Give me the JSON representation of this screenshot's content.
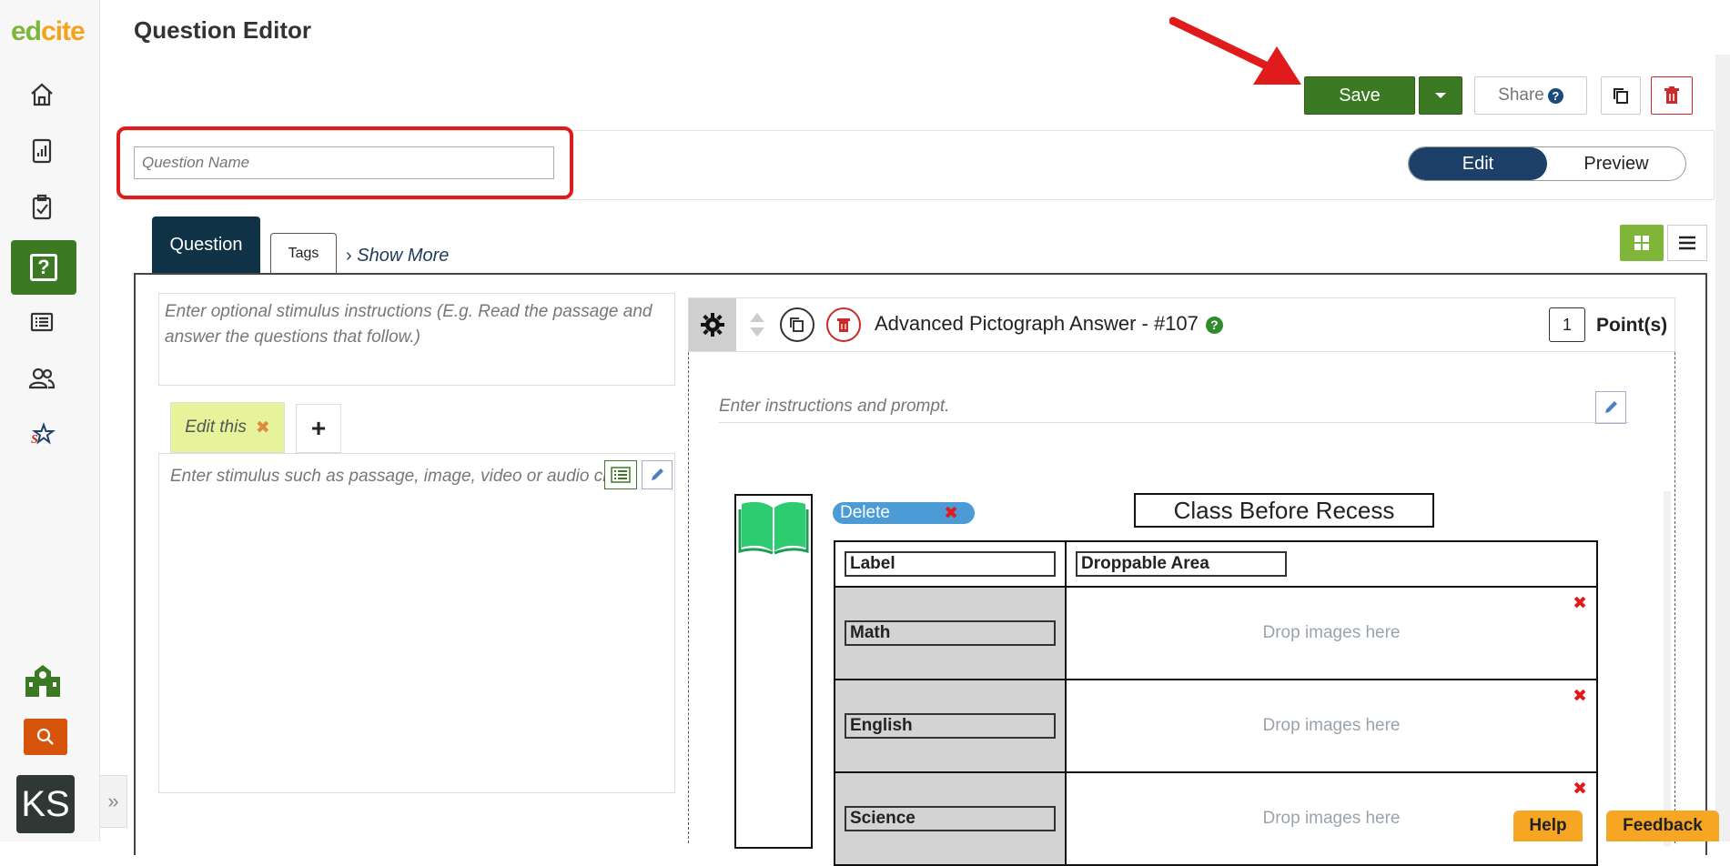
{
  "brand": {
    "logo_text_1": "ed",
    "logo_text_2": "cite"
  },
  "sidebar": {
    "items": [
      {
        "icon": "home-icon"
      },
      {
        "icon": "reports-icon"
      },
      {
        "icon": "assignments-icon"
      },
      {
        "icon": "question-icon",
        "active": true,
        "glyph": "?"
      },
      {
        "icon": "list-icon"
      },
      {
        "icon": "users-icon"
      },
      {
        "icon": "star-logo-icon"
      }
    ],
    "bottom": {
      "school_icon": "school-icon",
      "search_icon": "search-icon",
      "avatar_initials": "KS",
      "collapse": "»"
    }
  },
  "header": {
    "title": "Question Editor",
    "save_label": "Save",
    "share_label": "Share",
    "share_help": "?"
  },
  "name_field": {
    "placeholder": "Question Name",
    "value": ""
  },
  "mode_toggle": {
    "edit": "Edit",
    "preview": "Preview",
    "selected": "Edit"
  },
  "tabs": {
    "question": "Question",
    "tags": "Tags",
    "show_more": "Show More"
  },
  "stimulus": {
    "instructions_placeholder": "Enter optional stimulus instructions (E.g. Read the passage and answer the questions that follow.)",
    "tab_label": "Edit this",
    "tab_close": "✖",
    "add_label": "+",
    "body_placeholder": "Enter stimulus such as passage, image, video or audio clip"
  },
  "question": {
    "title": "Advanced Pictograph Answer - #107",
    "help": "?",
    "points_value": "1",
    "points_label": "Point(s)",
    "prompt_placeholder": "Enter instructions and prompt."
  },
  "pictograph": {
    "delete_label": "Delete",
    "delete_x": "✖",
    "title": "Class Before Recess",
    "header": {
      "label": "Label",
      "droppable": "Droppable Area"
    },
    "rows": [
      {
        "label": "Math",
        "drop": "Drop images here",
        "remove": "✖"
      },
      {
        "label": "English",
        "drop": "Drop images here",
        "remove": "✖"
      },
      {
        "label": "Science",
        "drop": "Drop images here",
        "remove": "✖"
      }
    ]
  },
  "footer": {
    "help": "Help",
    "feedback": "Feedback"
  },
  "colors": {
    "primary_green": "#3b7a23",
    "navy": "#1d4068",
    "highlight_red": "#e01b1b",
    "accent_orange": "#f6a622"
  }
}
